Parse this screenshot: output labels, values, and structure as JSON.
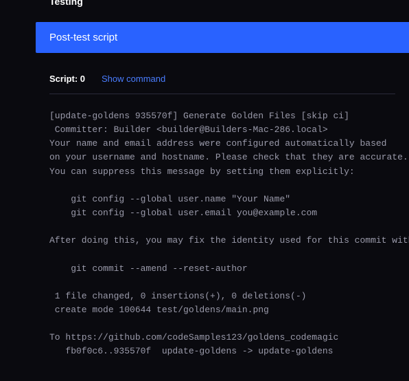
{
  "section": {
    "title": "Testing"
  },
  "banner": {
    "label": "Post-test script"
  },
  "script": {
    "label": "Script: 0",
    "show_command": "Show command"
  },
  "log": {
    "content": "[update-goldens 935570f] Generate Golden Files [skip ci]\n Committer: Builder <builder@Builders-Mac-286.local>\nYour name and email address were configured automatically based\non your username and hostname. Please check that they are accurate.\nYou can suppress this message by setting them explicitly:\n\n    git config --global user.name \"Your Name\"\n    git config --global user.email you@example.com\n\nAfter doing this, you may fix the identity used for this commit with:\n\n    git commit --amend --reset-author\n\n 1 file changed, 0 insertions(+), 0 deletions(-)\n create mode 100644 test/goldens/main.png\n\nTo https://github.com/codeSamples123/goldens_codemagic\n   fb0f0c6..935570f  update-goldens -> update-goldens"
  }
}
